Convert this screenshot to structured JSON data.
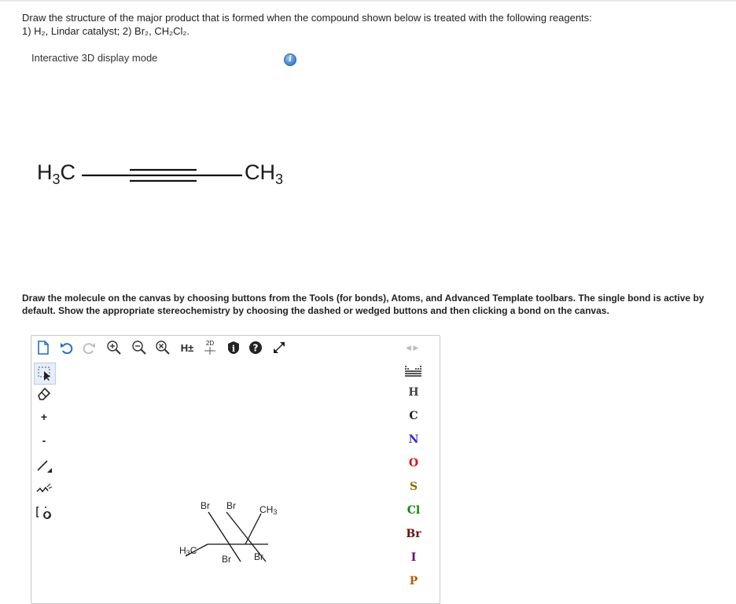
{
  "question": {
    "line1": "Draw the structure of the major product that is formed when the compound shown below is treated with the following reagents:",
    "line2": "1) H₂, Lindar catalyst; 2) Br₂, CH₂Cl₂."
  },
  "display_mode": {
    "label": "Interactive 3D display mode",
    "info": "i"
  },
  "molecule": {
    "left_group": "H",
    "left_sub": "3",
    "left_tail": "C",
    "right_group": "CH",
    "right_sub": "3"
  },
  "instructions": "Draw the molecule on the canvas by choosing buttons from the Tools (for bonds), Atoms, and Advanced Template toolbars. The single bond is active by default. Show the appropriate stereochemistry by choosing the dashed or wedged buttons and then clicking a bond on the canvas.",
  "toolbar_top": {
    "h_label": "H±",
    "two_d_label": "2D",
    "help_label": "?",
    "info_label": "i"
  },
  "toolbar_left": {
    "plus_label": "+",
    "minus_label": "-"
  },
  "atoms": [
    "H",
    "C",
    "N",
    "O",
    "S",
    "Cl",
    "Br",
    "I",
    "P"
  ],
  "atom_colors": {
    "H": "#444444",
    "C": "#222222",
    "N": "#2a2ad0",
    "O": "#e01010",
    "S": "#8a7000",
    "Cl": "#0a8a0a",
    "Br": "#6a1010",
    "I": "#6a0080",
    "P": "#b06000"
  },
  "canvas": {
    "br1": "Br",
    "br2": "Br",
    "br3": "Br",
    "br4": "Br",
    "ch3": "CH",
    "ch3_sub": "3",
    "h3c": "H",
    "h3c_sub": "3",
    "h3c_tail": "C"
  }
}
